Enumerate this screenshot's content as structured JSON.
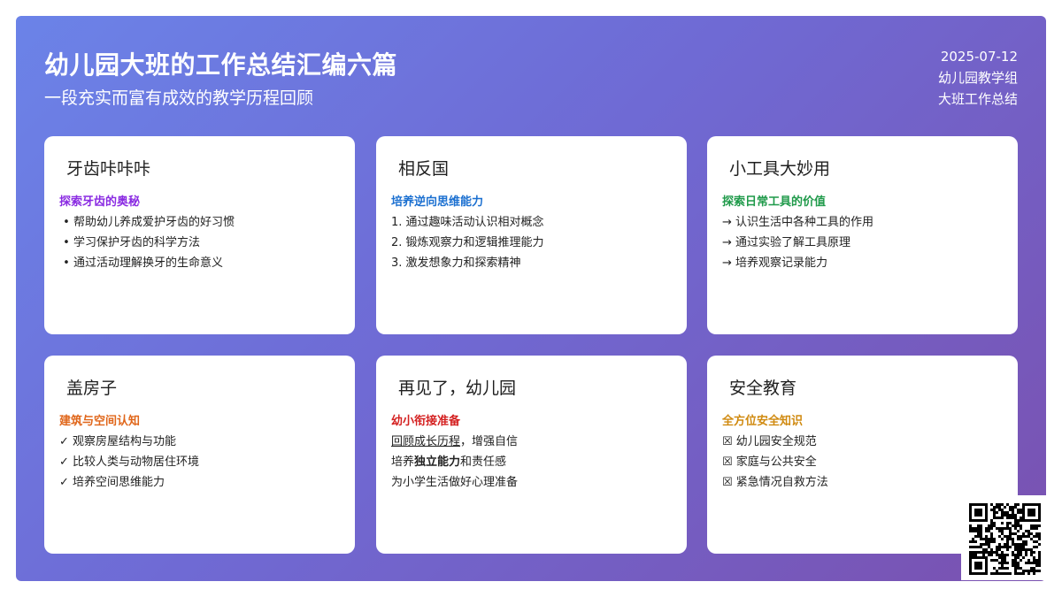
{
  "header": {
    "title": "幼儿园大班的工作总结汇编六篇",
    "subtitle": "一段充实而富有成效的教学历程回顾",
    "date": "2025-07-12",
    "group": "幼儿园教学组",
    "tag": "大班工作总结"
  },
  "colors": {
    "purple": "#8a2be2",
    "blue": "#1a6fd0",
    "green": "#1f9a4a",
    "orange": "#e0661a",
    "red": "#d42020",
    "amber": "#d08a10"
  },
  "cards": [
    {
      "title": "牙齿咔咔咔",
      "subtitle": "探索牙齿的奥秘",
      "items": [
        "帮助幼儿养成爱护牙齿的好习惯",
        "学习保护牙齿的科学方法",
        "通过活动理解换牙的生命意义"
      ]
    },
    {
      "title": "相反国",
      "subtitle": "培养逆向思维能力",
      "items": [
        "1. 通过趣味活动认识相对概念",
        "2. 锻炼观察力和逻辑推理能力",
        "3. 激发想象力和探索精神"
      ]
    },
    {
      "title": "小工具大妙用",
      "subtitle": "探索日常工具的价值",
      "items": [
        "→ 认识生活中各种工具的作用",
        "→ 通过实验了解工具原理",
        "→ 培养观察记录能力"
      ]
    },
    {
      "title": "盖房子",
      "subtitle": "建筑与空间认知",
      "items": [
        "✓ 观察房屋结构与功能",
        "✓ 比较人类与动物居住环境",
        "✓ 培养空间思维能力"
      ]
    },
    {
      "title": "再见了，幼儿园",
      "subtitle": "幼小衔接准备",
      "line1_u": "回顾成长历程",
      "line1_rest": "，增强自信",
      "line2_a": "培养",
      "line2_b": "独立能力",
      "line2_c": "和责任感",
      "line3": "为小学生活做好心理准备"
    },
    {
      "title": "安全教育",
      "subtitle": "全方位安全知识",
      "items": [
        "☒ 幼儿园安全规范",
        "☒ 家庭与公共安全",
        "☒ 紧急情况自救方法"
      ]
    }
  ]
}
